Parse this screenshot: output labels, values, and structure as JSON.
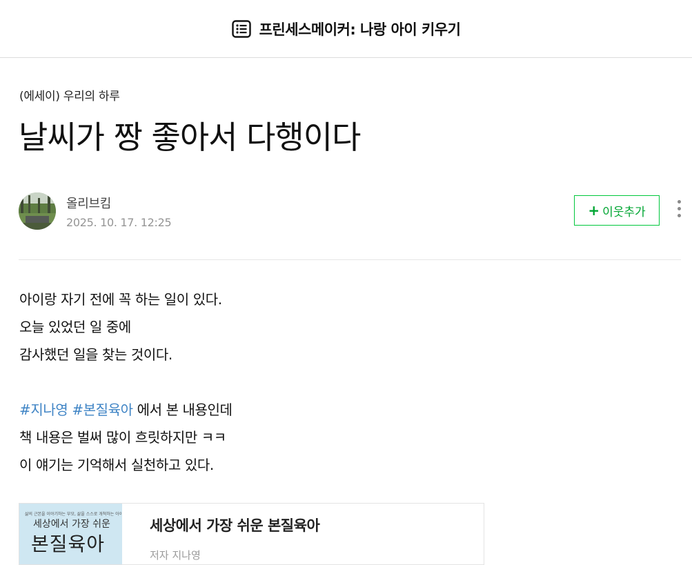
{
  "header": {
    "blog_title": "프린세스메이커: 나랑 아이 키우기",
    "menu_icon": "list-menu-icon"
  },
  "post": {
    "category": "(에세이) 우리의 하루",
    "title": "날씨가 짱 좋아서 다행이다",
    "author": {
      "name": "올리브킴",
      "date": "2025. 10. 17. 12:25",
      "avatar_icon": "profile-avatar"
    },
    "add_neighbor": {
      "plus": "+",
      "label": "이웃추가"
    },
    "more_icon": "more-vertical-icon",
    "body": {
      "line1": "아이랑 자기 전에 꼭 하는 일이 있다.",
      "line2": "오늘 있었던 일 중에",
      "line3": "감사했던 일을 찾는 것이다.",
      "hashtag1": "#지나영",
      "hashtag2": "#본질육아",
      "line4_rest": " 에서 본 내용인데",
      "line5": "책 내용은 벌써 많이 흐릿하지만 ㅋㅋ",
      "line6": "이 얘기는 기억해서 실천하고 있다."
    },
    "book_card": {
      "cover_subtitle": "삶의 근본을 이야기하는 부모, 삶을 스스로 개척하는 아이",
      "cover_small": "세상에서 가장 쉬운",
      "cover_big": "본질육아",
      "title": "세상에서 가장 쉬운 본질육아",
      "meta": "저자 지나영"
    }
  },
  "colors": {
    "accent_green": "#00c73c",
    "hashtag_blue": "#3f84c5",
    "date_gray": "#959595"
  }
}
